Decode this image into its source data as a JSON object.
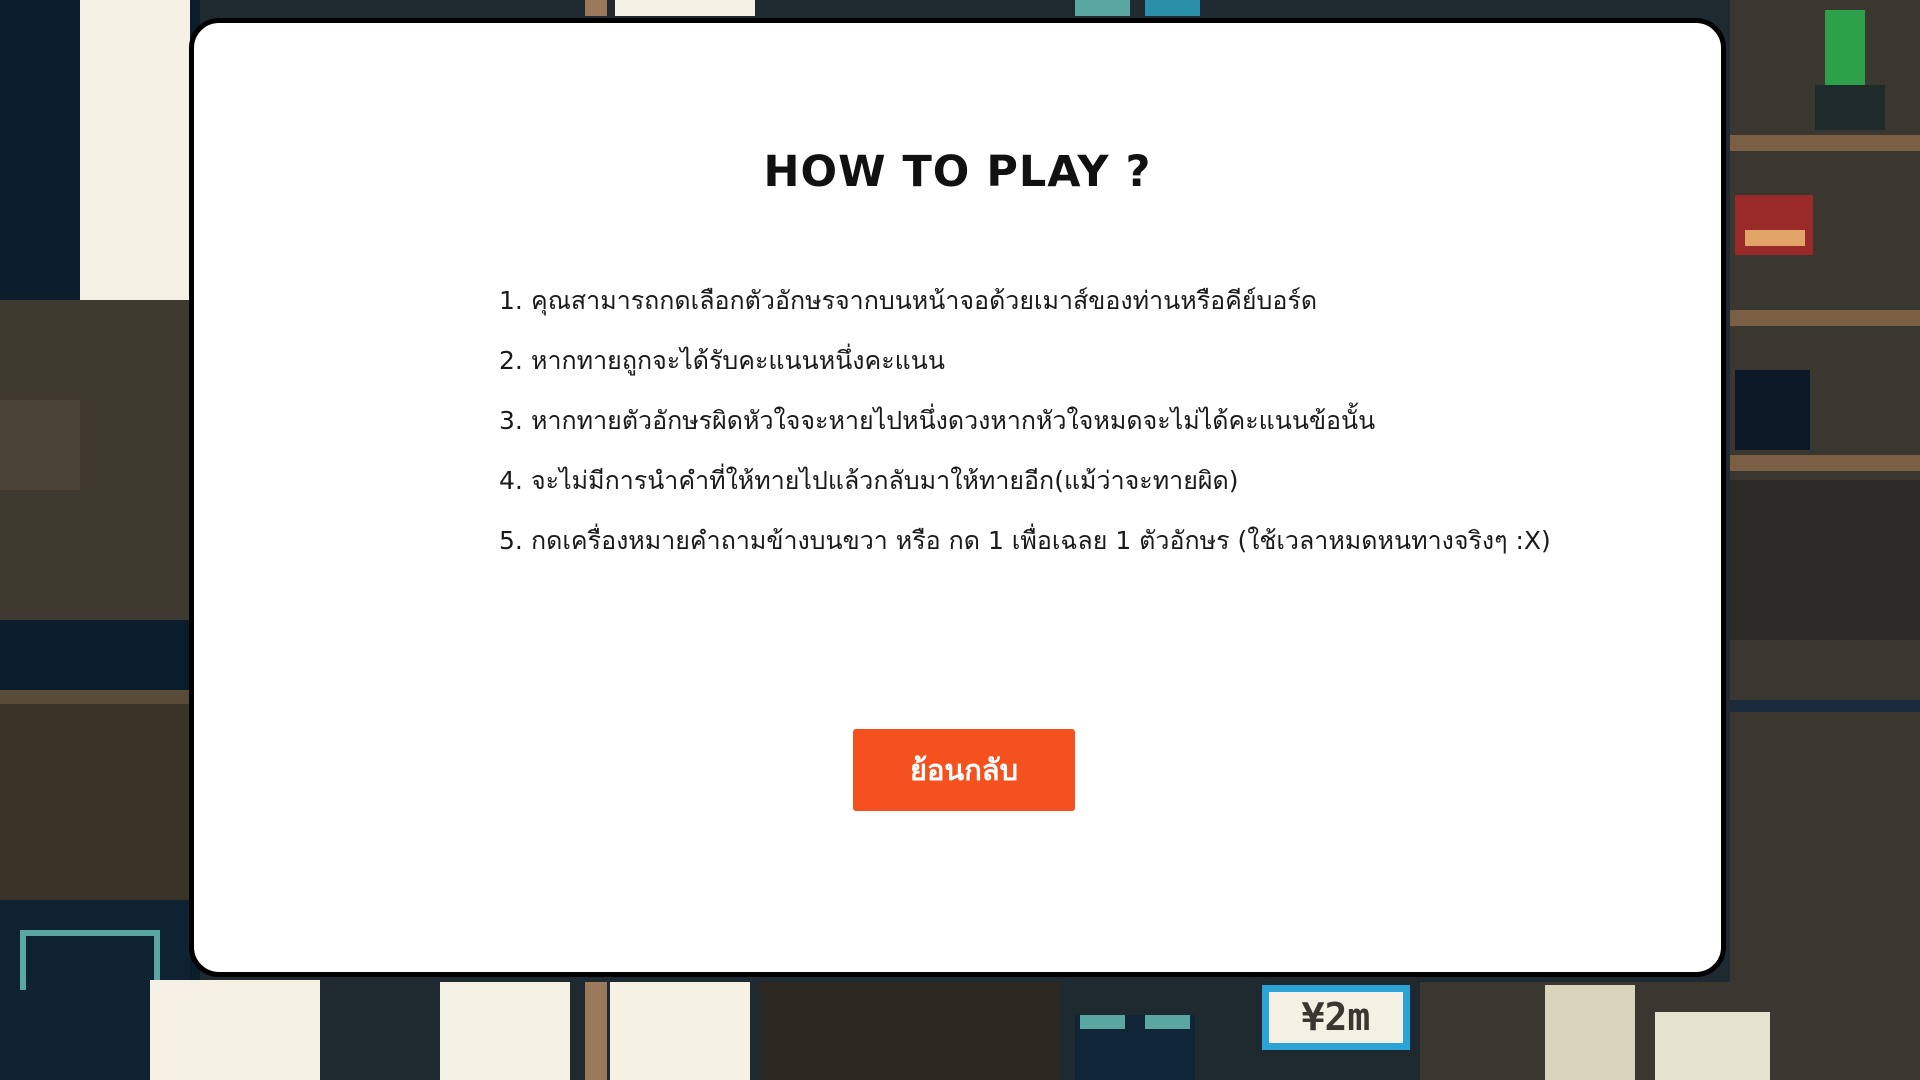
{
  "modal": {
    "title": "HOW TO PLAY ?",
    "rules": [
      {
        "num": "1.",
        "text": "คุณสามารถกดเลือกตัวอักษรจากบนหน้าจอด้วยเมาส์ของท่านหรือคีย์บอร์ด"
      },
      {
        "num": "2.",
        "text": "หากทายถูกจะได้รับคะแนนหนึ่งคะแนน"
      },
      {
        "num": "3.",
        "text": "หากทายตัวอักษรผิดหัวใจจะหายไปหนึ่งดวงหากหัวใจหมดจะไม่ได้คะแนนข้อนั้น"
      },
      {
        "num": "4.",
        "text": "จะไม่มีการนำคำที่ให้ทายไปแล้วกลับมาให้ทายอีก(แม้ว่าจะทายผิด)"
      },
      {
        "num": "5.",
        "text": "กดเครื่องหมายคำถามข้างบนขวา หรือ กด 1 เพื่อเฉลย 1 ตัวอักษร (ใช้เวลาหมดหนทางจริงๆ :X)"
      }
    ],
    "back_button_label": "ย้อนกลับ"
  },
  "background": {
    "sign_text": "¥2m"
  },
  "colors": {
    "accent": "#f4511e",
    "modal_bg": "#ffffff",
    "modal_border": "#000000"
  }
}
